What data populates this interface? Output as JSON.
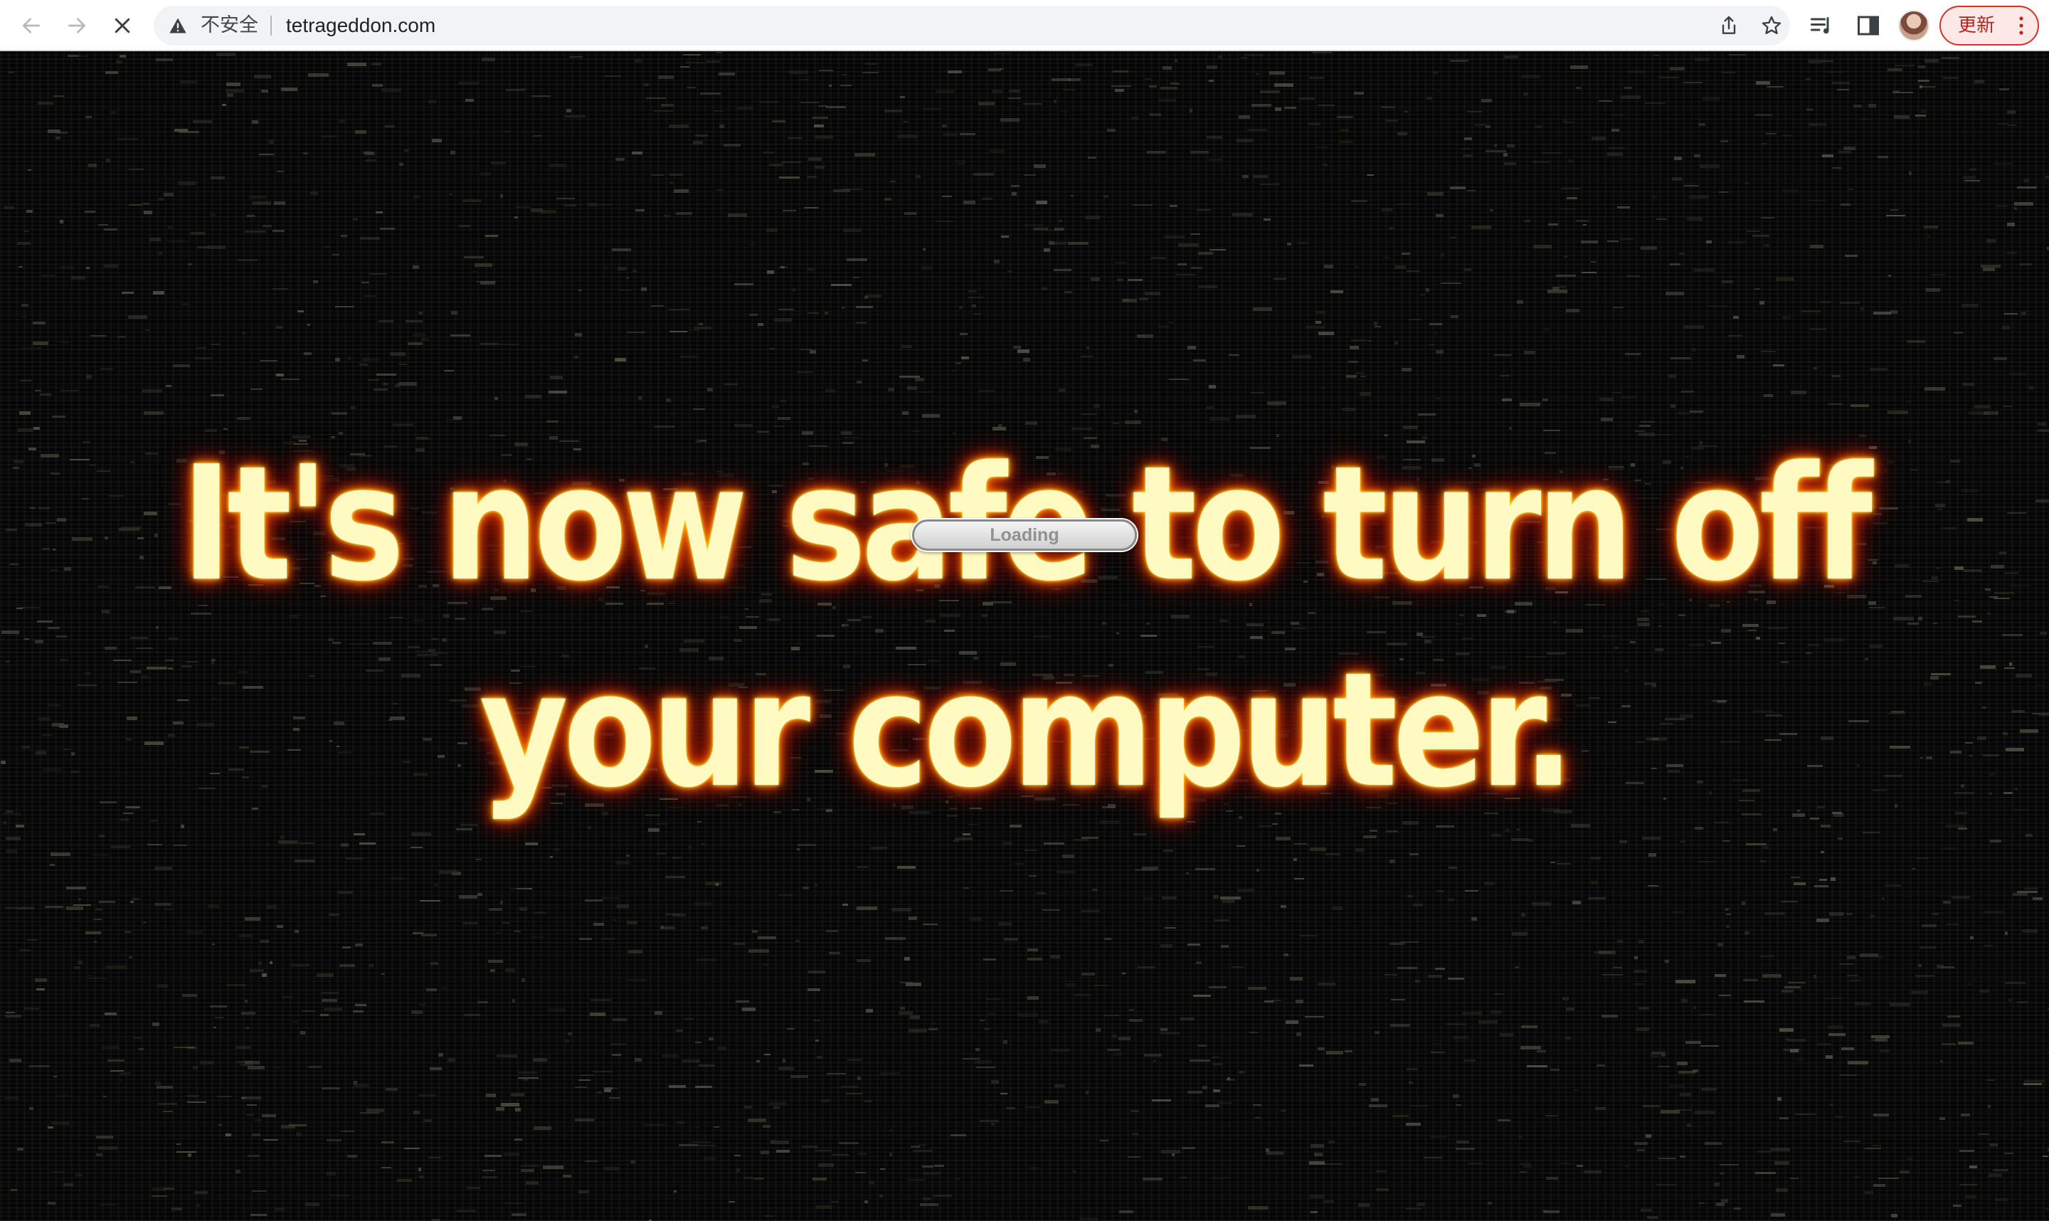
{
  "browser": {
    "security_label": "不安全",
    "url": "tetrageddon.com",
    "update_label": "更新",
    "icons": {
      "back": "back-arrow-icon",
      "forward": "forward-arrow-icon",
      "stop": "close-icon",
      "security": "warning-triangle-icon",
      "share": "share-icon",
      "bookmark": "star-icon",
      "reading_list": "reading-list-icon",
      "side_panel": "side-panel-icon",
      "menu": "kebab-menu-icon"
    },
    "colors": {
      "update_accent": "#d93025"
    }
  },
  "page": {
    "headline_line1": "It's now safe to turn off",
    "headline_line2": "your computer.",
    "loading_label": "Loading",
    "colors": {
      "background": "#050505",
      "text_core": "#fff9c2",
      "glow": "#ff6a00"
    }
  }
}
